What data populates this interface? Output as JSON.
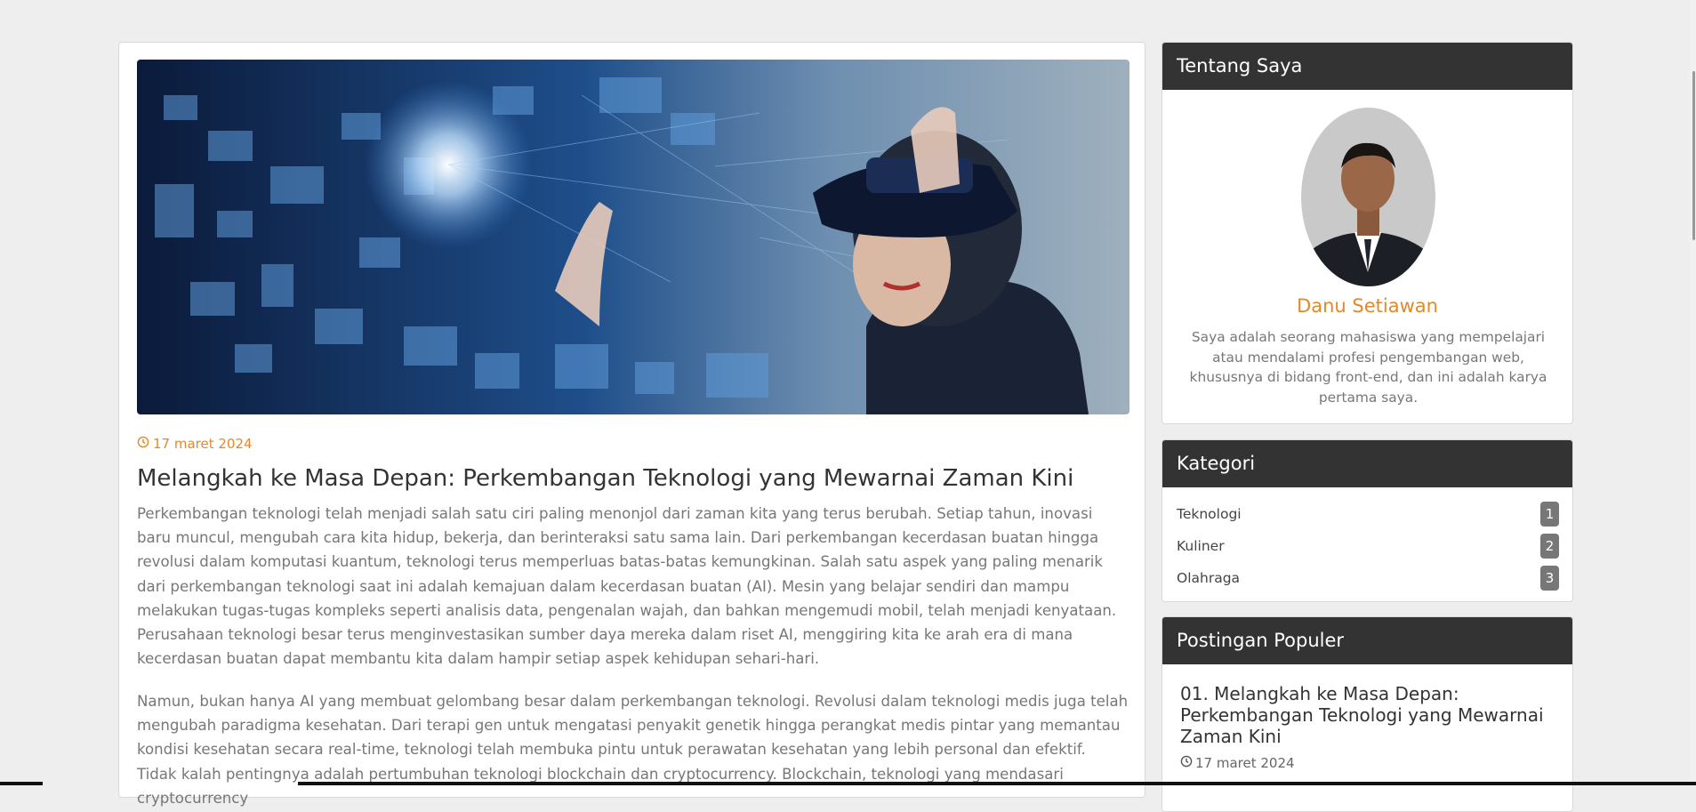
{
  "article": {
    "date": "17 maret 2024",
    "title": "Melangkah ke Masa Depan: Perkembangan Teknologi yang Mewarnai Zaman Kini",
    "paragraphs": [
      "Perkembangan teknologi telah menjadi salah satu ciri paling menonjol dari zaman kita yang terus berubah. Setiap tahun, inovasi baru muncul, mengubah cara kita hidup, bekerja, dan berinteraksi satu sama lain. Dari perkembangan kecerdasan buatan hingga revolusi dalam komputasi kuantum, teknologi terus memperluas batas-batas kemungkinan. Salah satu aspek yang paling menarik dari perkembangan teknologi saat ini adalah kemajuan dalam kecerdasan buatan (AI). Mesin yang belajar sendiri dan mampu melakukan tugas-tugas kompleks seperti analisis data, pengenalan wajah, dan bahkan mengemudi mobil, telah menjadi kenyataan. Perusahaan teknologi besar terus menginvestasikan sumber daya mereka dalam riset AI, menggiring kita ke arah era di mana kecerdasan buatan dapat membantu kita dalam hampir setiap aspek kehidupan sehari-hari.",
      "Namun, bukan hanya AI yang membuat gelombang besar dalam perkembangan teknologi. Revolusi dalam teknologi medis juga telah mengubah paradigma kesehatan. Dari terapi gen untuk mengatasi penyakit genetik hingga perangkat medis pintar yang memantau kondisi kesehatan secara real-time, teknologi telah membuka pintu untuk perawatan kesehatan yang lebih personal dan efektif. Tidak kalah pentingnya adalah pertumbuhan teknologi blockchain dan cryptocurrency. Blockchain, teknologi yang mendasari cryptocurrency"
    ]
  },
  "sidebar": {
    "about": {
      "heading": "Tentang Saya",
      "name": "Danu Setiawan",
      "bio": "Saya adalah seorang mahasiswa yang mempelajari atau mendalami profesi pengembangan web, khususnya di bidang front-end, dan ini adalah karya pertama saya."
    },
    "categories": {
      "heading": "Kategori",
      "items": [
        {
          "label": "Teknologi",
          "count": "1"
        },
        {
          "label": "Kuliner",
          "count": "2"
        },
        {
          "label": "Olahraga",
          "count": "3"
        }
      ]
    },
    "popular": {
      "heading": "Postingan Populer",
      "items": [
        {
          "title": "01. Melangkah ke Masa Depan: Perkembangan Teknologi yang Mewarnai Zaman Kini",
          "date": "17 maret 2024"
        }
      ]
    }
  },
  "icons": {
    "date_icon": "clock-icon"
  },
  "colors": {
    "accent": "#e3892a",
    "widget_header": "#333333",
    "badge": "#777777",
    "body_text": "#777777"
  }
}
